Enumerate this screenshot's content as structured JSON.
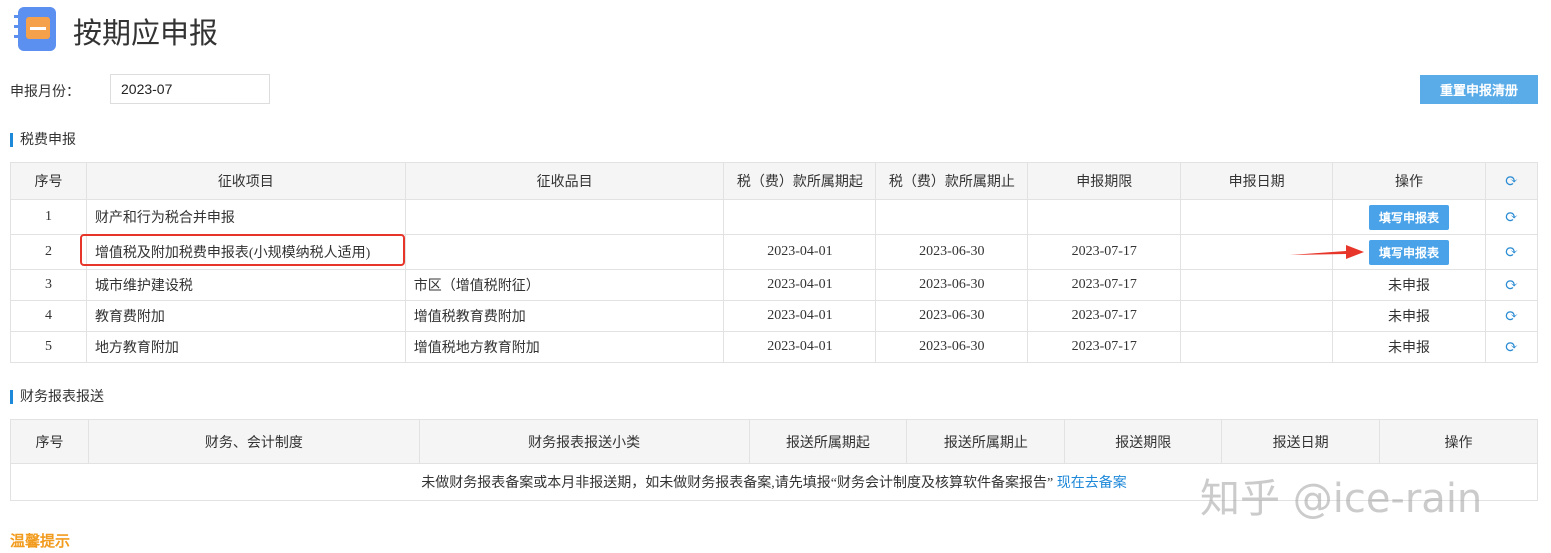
{
  "header": {
    "title": "按期应申报"
  },
  "month": {
    "label": "申报月份：",
    "value": "2023-07"
  },
  "reset_label": "重置申报清册",
  "tax": {
    "section_title": "税费申报",
    "columns": [
      "序号",
      "征收项目",
      "征收品目",
      "税（费）款所属期起",
      "税（费）款所属期止",
      "申报期限",
      "申报日期",
      "操作"
    ],
    "rows": [
      {
        "no": "1",
        "item": "财产和行为税合并申报",
        "sub": "",
        "start": "",
        "end": "",
        "deadline": "",
        "date": "",
        "action": "填写申报表",
        "action_type": "button"
      },
      {
        "no": "2",
        "item": "增值税及附加税费申报表(小规模纳税人适用)",
        "sub": "",
        "start": "2023-04-01",
        "end": "2023-06-30",
        "deadline": "2023-07-17",
        "date": "",
        "action": "填写申报表",
        "action_type": "button"
      },
      {
        "no": "3",
        "item": "城市维护建设税",
        "sub": "市区（增值税附征）",
        "start": "2023-04-01",
        "end": "2023-06-30",
        "deadline": "2023-07-17",
        "date": "",
        "action": "未申报",
        "action_type": "text"
      },
      {
        "no": "4",
        "item": "教育费附加",
        "sub": "增值税教育费附加",
        "start": "2023-04-01",
        "end": "2023-06-30",
        "deadline": "2023-07-17",
        "date": "",
        "action": "未申报",
        "action_type": "text"
      },
      {
        "no": "5",
        "item": "地方教育附加",
        "sub": "增值税地方教育附加",
        "start": "2023-04-01",
        "end": "2023-06-30",
        "deadline": "2023-07-17",
        "date": "",
        "action": "未申报",
        "action_type": "text"
      }
    ]
  },
  "fin": {
    "section_title": "财务报表报送",
    "columns": [
      "序号",
      "财务、会计制度",
      "财务报表报送小类",
      "报送所属期起",
      "报送所属期止",
      "报送期限",
      "报送日期",
      "操作"
    ],
    "empty_text": "未做财务报表备案或本月非报送期，如未做财务报表备案,请先填报“财务会计制度及核算软件备案报告”",
    "empty_link": "现在去备案"
  },
  "tips_title": "温馨提示",
  "watermark": "知乎 @ice-rain"
}
